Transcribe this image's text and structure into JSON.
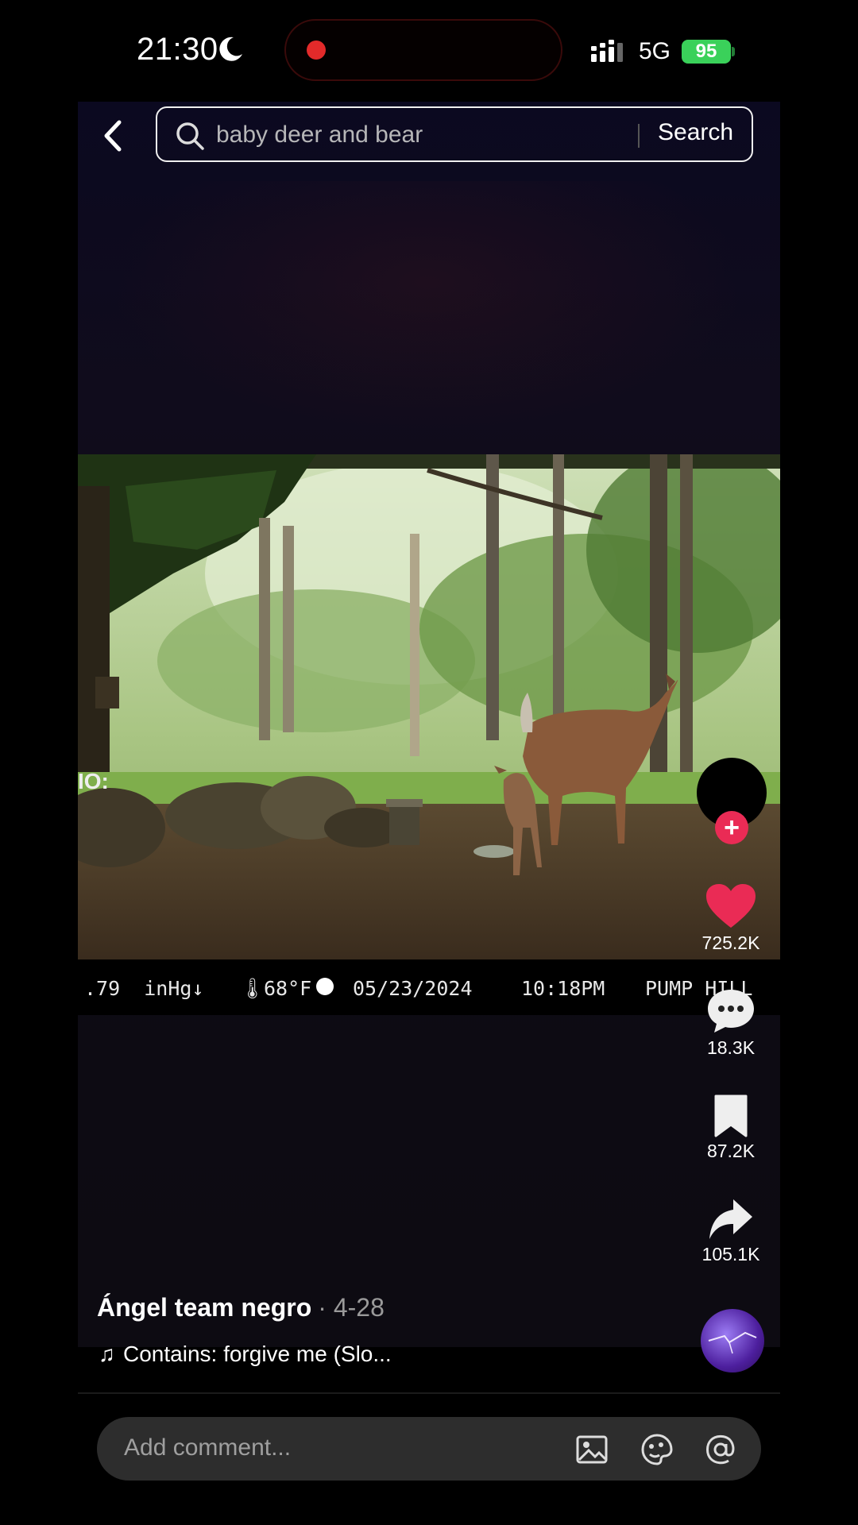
{
  "status_bar": {
    "time": "21:30",
    "network": "5G",
    "battery": "95"
  },
  "search": {
    "query": "baby deer and bear",
    "button_label": "Search"
  },
  "video": {
    "overlay_pressure": ".79  inHg↓",
    "overlay_temp": "68°F",
    "overlay_date": "05/23/2024",
    "overlay_time": "10:18PM",
    "overlay_location": "PUMP HILL",
    "edge_text": "IO:"
  },
  "actions": {
    "likes": "725.2K",
    "comments": "18.3K",
    "saves": "87.2K",
    "shares": "105.1K"
  },
  "post": {
    "author": "Ángel team negro",
    "date": "· 4-28",
    "music": "Contains: forgive me (Slo..."
  },
  "comment": {
    "placeholder": "Add comment..."
  },
  "colors": {
    "like": "#ea2b55",
    "battery": "#3ad15a",
    "record": "#e32a2a"
  },
  "icons": [
    "back-icon",
    "search-icon",
    "heart-icon",
    "comment-icon",
    "bookmark-icon",
    "share-icon",
    "image-icon",
    "emoji-icon",
    "mention-icon",
    "moon-icon",
    "signal-icon"
  ]
}
